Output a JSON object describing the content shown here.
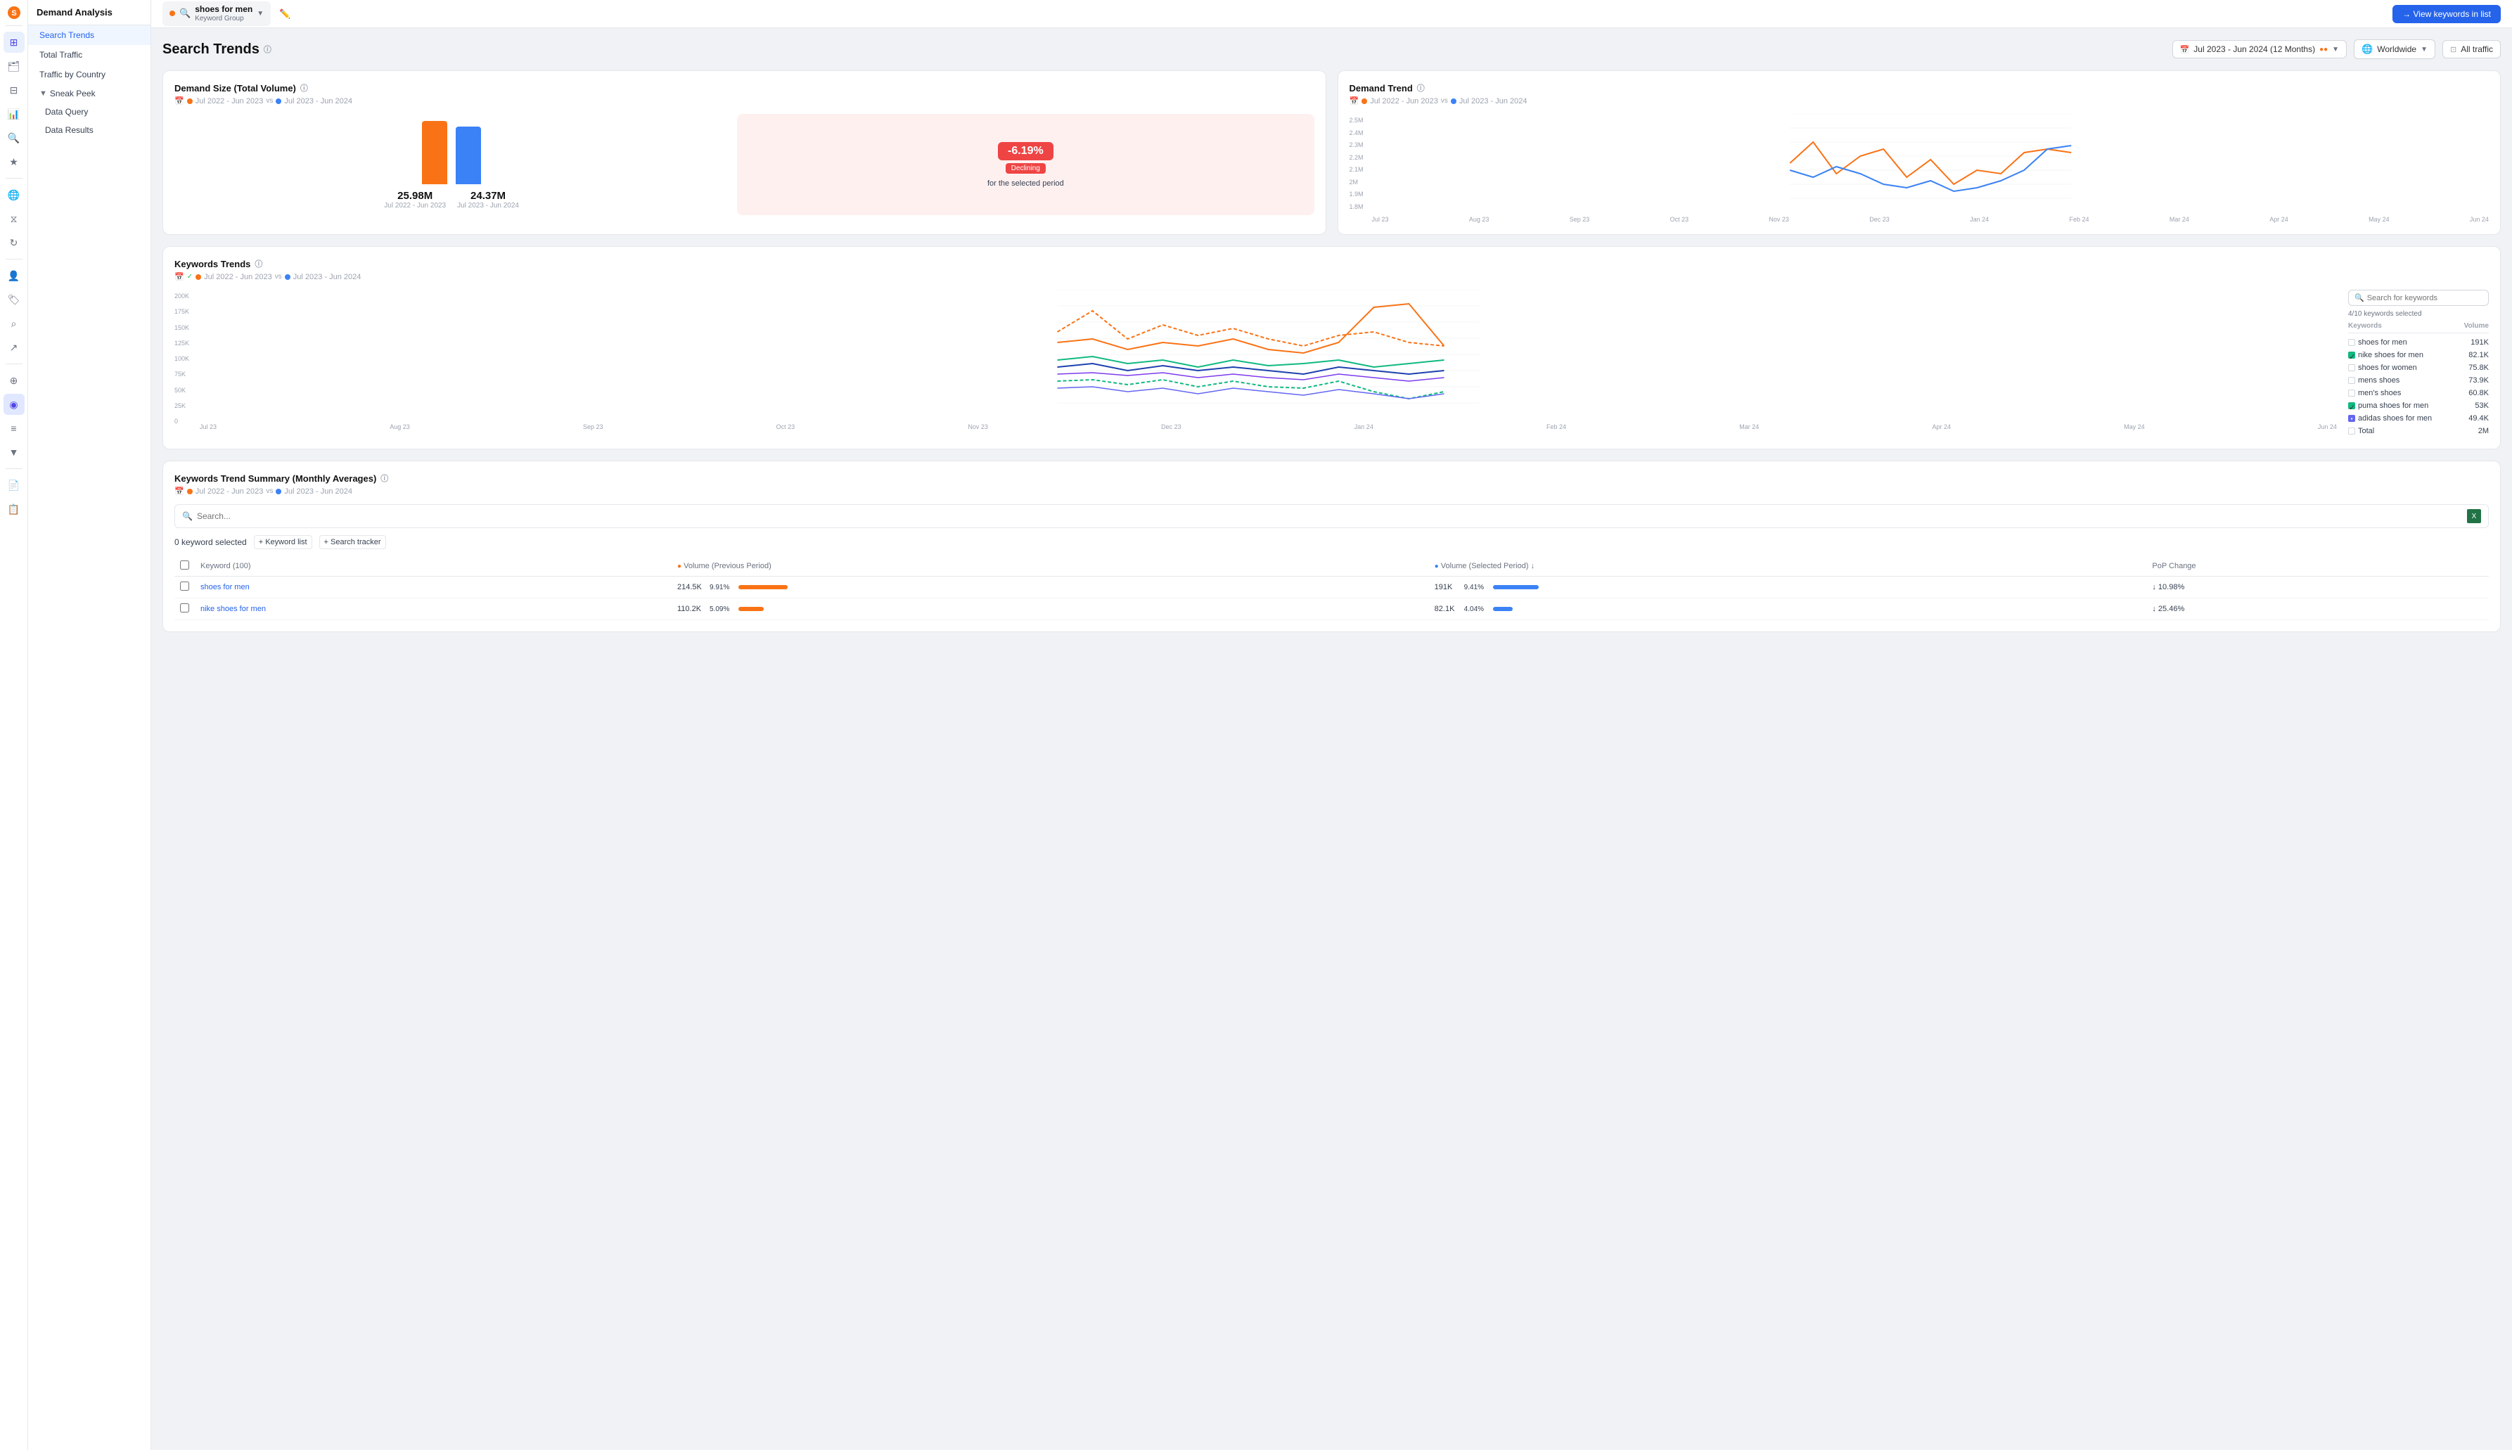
{
  "app": {
    "brand": "Demand Analysis"
  },
  "topbar": {
    "keyword_group_name": "shoes for men",
    "keyword_group_sub": "Keyword Group",
    "edit_icon": "✏️",
    "view_btn": "→ View keywords in list"
  },
  "nav": {
    "items": [
      {
        "id": "search-trends",
        "label": "Search Trends",
        "active": true
      },
      {
        "id": "total-traffic",
        "label": "Total Traffic",
        "active": false
      },
      {
        "id": "traffic-by-country",
        "label": "Traffic by Country",
        "active": false
      }
    ],
    "sneak_peek_label": "Sneak Peek",
    "sneak_peek_items": [
      {
        "id": "data-query",
        "label": "Data Query"
      },
      {
        "id": "data-results",
        "label": "Data Results"
      }
    ]
  },
  "page": {
    "title": "Search Trends",
    "info_icon": "ⓘ",
    "date_range": "Jul 2023 - Jun 2024 (12 Months)",
    "region": "Worldwide",
    "traffic": "All traffic"
  },
  "demand_size": {
    "title": "Demand Size (Total Volume)",
    "period1": "Jul 2022 - Jun 2023",
    "period2": "Jul 2023 - Jun 2024",
    "vs": "vs",
    "bar1_value": "25.98M",
    "bar1_period": "Jul 2022 - Jun 2023",
    "bar2_value": "24.37M",
    "bar2_period": "Jul 2023 - Jun 2024",
    "change_pct": "-6.19%",
    "change_label": "Declining",
    "change_desc": "for the selected period"
  },
  "demand_trend": {
    "title": "Demand Trend",
    "period1": "Jul 2022 - Jun 2023",
    "period2": "Jul 2023 - Jun 2024",
    "vs": "vs",
    "y_labels": [
      "2.5M",
      "2.4M",
      "2.3M",
      "2.2M",
      "2.1M",
      "2M",
      "1.9M",
      "1.8M"
    ],
    "x_labels": [
      "Jul 23",
      "Aug 23",
      "Sep 23",
      "Oct 23",
      "Nov 23",
      "Dec 23",
      "Jan 24",
      "Feb 24",
      "Mar 24",
      "Apr 24",
      "May 24",
      "Jun 24"
    ]
  },
  "keywords_trends": {
    "title": "Keywords Trends",
    "period1": "Jul 2022 - Jun 2023",
    "period2": "Jul 2023 - Jun 2024",
    "vs": "vs",
    "y_labels": [
      "200K",
      "175K",
      "150K",
      "125K",
      "100K",
      "75K",
      "50K",
      "25K",
      "0"
    ],
    "x_labels": [
      "Jul 23",
      "Aug 23",
      "Sep 23",
      "Oct 23",
      "Nov 23",
      "Dec 23",
      "Jan 24",
      "Feb 24",
      "Mar 24",
      "Apr 24",
      "May 24",
      "Jun 24"
    ],
    "search_placeholder": "Search for keywords",
    "selected_count": "4/10 keywords selected",
    "col_keywords": "Keywords",
    "col_volume": "Volume",
    "keywords": [
      {
        "name": "shoes for men",
        "volume": "191K",
        "checked": false,
        "color": "#f97316"
      },
      {
        "name": "nike shoes for men",
        "volume": "82.1K",
        "checked": true,
        "color": "#f97316"
      },
      {
        "name": "shoes for women",
        "volume": "75.8K",
        "checked": false,
        "color": "#10b981"
      },
      {
        "name": "mens shoes",
        "volume": "73.9K",
        "checked": false,
        "color": "#1e40af"
      },
      {
        "name": "men's shoes",
        "volume": "60.8K",
        "checked": false,
        "color": "#7c3aed"
      },
      {
        "name": "puma shoes for men",
        "volume": "53K",
        "checked": true,
        "color": "#10b981"
      },
      {
        "name": "adidas shoes for men",
        "volume": "49.4K",
        "checked": false,
        "color": "#6366f1"
      },
      {
        "name": "Total",
        "volume": "2M",
        "checked": false,
        "color": "#9ca3af"
      }
    ]
  },
  "keywords_summary": {
    "title": "Keywords Trend Summary (Monthly Averages)",
    "period1": "Jul 2022 - Jun 2023",
    "period2": "Jul 2023 - Jun 2024",
    "vs": "vs",
    "search_placeholder": "Search...",
    "selected_count": "0 keyword selected",
    "add_to_list": "+ Keyword list",
    "add_tracker": "+ Search tracker",
    "col_keyword": "Keyword (100)",
    "col_vol_prev": "● Volume (Previous Period)",
    "col_vol_sel": "● Volume (Selected Period) ↓",
    "col_pop": "PoP Change",
    "rows": [
      {
        "keyword": "shoes for men",
        "vol_prev": "214.5K",
        "vol_prev_pct": "9.91%",
        "vol_prev_bar": 70,
        "vol_sel": "191K",
        "vol_sel_pct": "9.41%",
        "vol_sel_bar": 65,
        "pop": "↓ 10.98%",
        "pop_dir": "down"
      },
      {
        "keyword": "nike shoes for men",
        "vol_prev": "110.2K",
        "vol_prev_pct": "5.09%",
        "vol_prev_bar": 36,
        "vol_sel": "82.1K",
        "vol_sel_pct": "4.04%",
        "vol_sel_bar": 28,
        "pop": "↓ 25.46%",
        "pop_dir": "down"
      }
    ]
  }
}
